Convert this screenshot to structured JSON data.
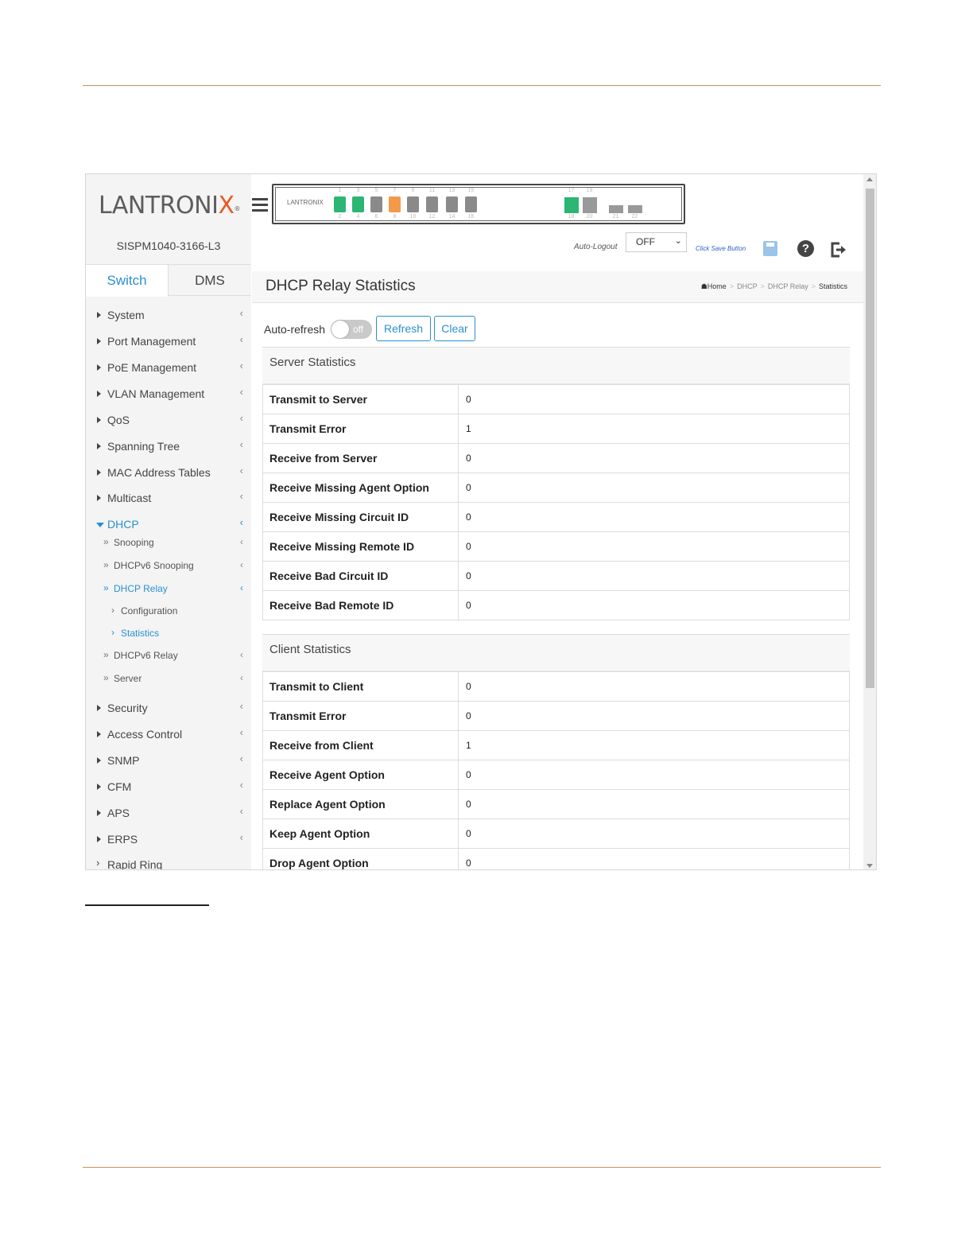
{
  "brand": {
    "logo_main": "LANTRONI",
    "logo_x": "X",
    "logo_reg": "®",
    "model": "SISPM1040-3166-L3",
    "panel_logo": "LANTRONIX"
  },
  "tabs": [
    {
      "label": "Switch"
    },
    {
      "label": "DMS"
    }
  ],
  "nav": {
    "items": [
      {
        "label": "System"
      },
      {
        "label": "Port Management"
      },
      {
        "label": "PoE Management"
      },
      {
        "label": "VLAN Management"
      },
      {
        "label": "QoS"
      },
      {
        "label": "Spanning Tree"
      },
      {
        "label": "MAC Address Tables"
      },
      {
        "label": "Multicast"
      },
      {
        "label": "DHCP"
      },
      {
        "label": "Security"
      },
      {
        "label": "Access Control"
      },
      {
        "label": "SNMP"
      },
      {
        "label": "CFM"
      },
      {
        "label": "APS"
      },
      {
        "label": "ERPS"
      },
      {
        "label": "Rapid Ring"
      }
    ],
    "dhcp_sub": [
      {
        "label": "Snooping"
      },
      {
        "label": "DHCPv6 Snooping"
      },
      {
        "label": "DHCP Relay"
      },
      {
        "label": "DHCPv6 Relay"
      },
      {
        "label": "Server"
      }
    ],
    "relay_sub": [
      {
        "label": "Configuration"
      },
      {
        "label": "Statistics"
      }
    ]
  },
  "ports": {
    "top": [
      "1",
      "3",
      "5",
      "7",
      "9",
      "11",
      "13",
      "15"
    ],
    "bottom": [
      "2",
      "4",
      "6",
      "8",
      "10",
      "12",
      "14",
      "16"
    ],
    "sfp_top": [
      "17",
      "19"
    ],
    "sfp_bottom": [
      "18",
      "20",
      "21",
      "22"
    ]
  },
  "header": {
    "auto_logout_label": "Auto-Logout",
    "auto_logout_value": "OFF",
    "save_hint": "Click Save Button",
    "help_glyph": "?"
  },
  "page": {
    "title": "DHCP Relay Statistics",
    "breadcrumb": {
      "home": "Home",
      "b1": "DHCP",
      "b2": "DHCP Relay",
      "current": "Statistics"
    }
  },
  "controls": {
    "auto_refresh_label": "Auto-refresh",
    "toggle_text": "off",
    "refresh": "Refresh",
    "clear": "Clear"
  },
  "server_stats": {
    "title": "Server Statistics",
    "rows": [
      {
        "label": "Transmit to Server",
        "value": "0"
      },
      {
        "label": "Transmit Error",
        "value": "1"
      },
      {
        "label": "Receive from Server",
        "value": "0"
      },
      {
        "label": "Receive Missing Agent Option",
        "value": "0"
      },
      {
        "label": "Receive Missing Circuit ID",
        "value": "0"
      },
      {
        "label": "Receive Missing Remote ID",
        "value": "0"
      },
      {
        "label": "Receive Bad Circuit ID",
        "value": "0"
      },
      {
        "label": "Receive Bad Remote ID",
        "value": "0"
      }
    ]
  },
  "client_stats": {
    "title": "Client Statistics",
    "rows": [
      {
        "label": "Transmit to Client",
        "value": "0"
      },
      {
        "label": "Transmit Error",
        "value": "0"
      },
      {
        "label": "Receive from Client",
        "value": "1"
      },
      {
        "label": "Receive Agent Option",
        "value": "0"
      },
      {
        "label": "Replace Agent Option",
        "value": "0"
      },
      {
        "label": "Keep Agent Option",
        "value": "0"
      },
      {
        "label": "Drop Agent Option",
        "value": "0"
      }
    ]
  }
}
